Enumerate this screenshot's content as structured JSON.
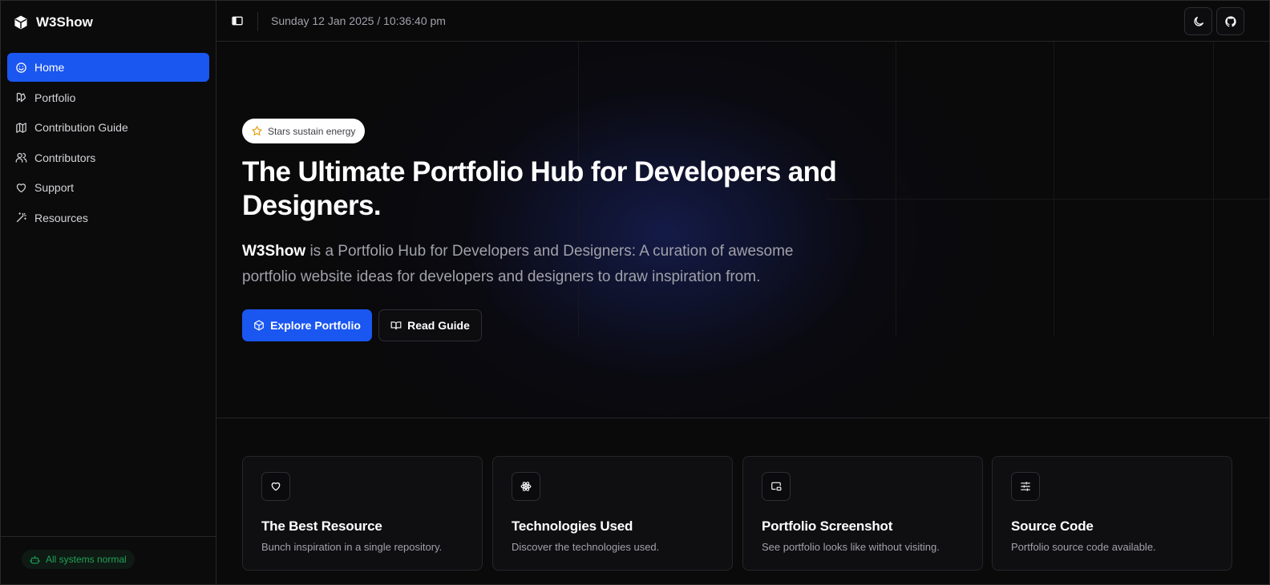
{
  "app": {
    "name": "W3Show"
  },
  "sidebar": {
    "items": [
      {
        "label": "Home",
        "icon": "smile-icon",
        "active": true
      },
      {
        "label": "Portfolio",
        "icon": "palette-icon",
        "active": false
      },
      {
        "label": "Contribution Guide",
        "icon": "map-icon",
        "active": false
      },
      {
        "label": "Contributors",
        "icon": "users-icon",
        "active": false
      },
      {
        "label": "Support",
        "icon": "heart-icon",
        "active": false
      },
      {
        "label": "Resources",
        "icon": "wand-icon",
        "active": false
      }
    ],
    "status": "All systems normal"
  },
  "header": {
    "datetime": "Sunday 12 Jan 2025 / 10:36:40 pm"
  },
  "hero": {
    "badge": "Stars sustain energy",
    "title": "The Ultimate Portfolio Hub for Developers and Designers.",
    "desc_brand": "W3Show",
    "desc_rest": " is a Portfolio Hub for Developers and Designers: A curation of awesome portfolio website ideas for developers and designers to draw inspiration from.",
    "primary_button": "Explore Portfolio",
    "secondary_button": "Read Guide"
  },
  "features": [
    {
      "title": "The Best Resource",
      "desc": "Bunch inspiration in a single repository.",
      "icon": "heart-icon"
    },
    {
      "title": "Technologies Used",
      "desc": "Discover the technologies used.",
      "icon": "atom-icon"
    },
    {
      "title": "Portfolio Screenshot",
      "desc": "See portfolio looks like without visiting.",
      "icon": "screenshot-icon"
    },
    {
      "title": "Source Code",
      "desc": "Portfolio source code available.",
      "icon": "sliders-icon"
    }
  ],
  "colors": {
    "accent": "#1a56f0",
    "background": "#0a0a0b",
    "status": "#22a05a",
    "star": "#e5a21a"
  }
}
